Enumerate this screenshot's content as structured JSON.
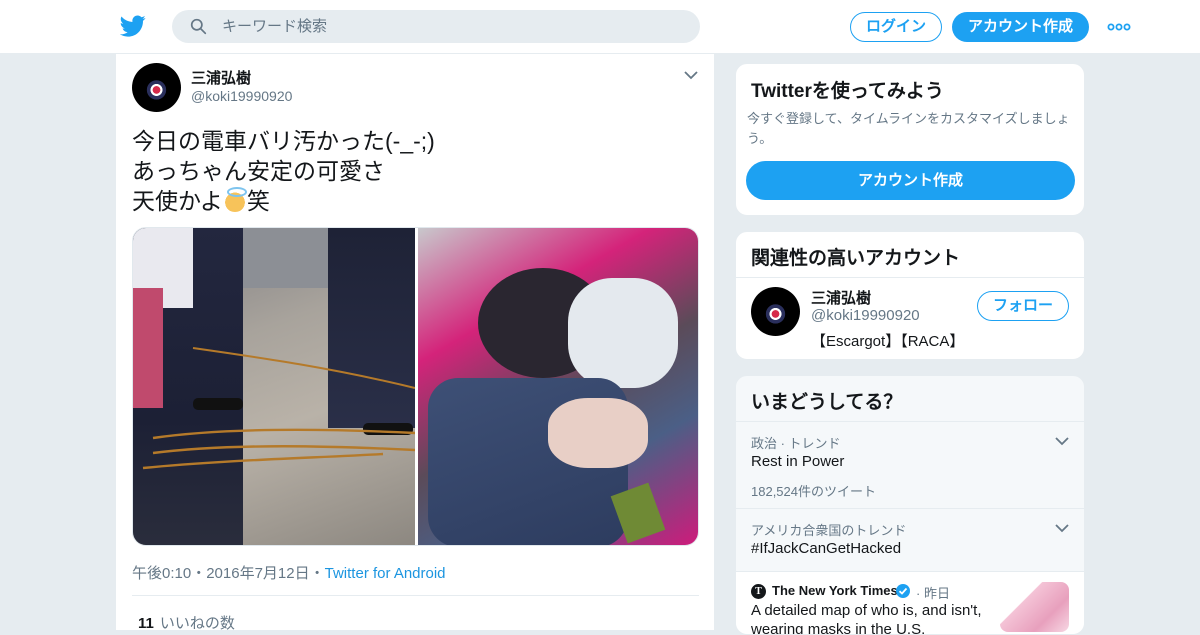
{
  "search": {
    "placeholder": "キーワード検索"
  },
  "nav": {
    "login_label": "ログイン",
    "signup_label": "アカウント作成"
  },
  "tweet": {
    "author_name": "三浦弘樹",
    "author_handle": "@koki19990920",
    "text_line1": "今日の電車バリ汚かった(-_-;)",
    "text_line2": "あっちゃん安定の可愛さ",
    "text_line3_before": "天使かよ",
    "text_line3_after": "笑",
    "time": "午後0:10",
    "date": "2016年7月12日",
    "sep": "・",
    "source": "Twitter for Android",
    "likes_count": "11",
    "likes_label": "いいねの数"
  },
  "signup_card": {
    "title": "Twitterを使ってみよう",
    "description": "今すぐ登録して、タイムラインをカスタマイズしましょう。",
    "button_label": "アカウント作成"
  },
  "related_card": {
    "title": "関連性の高いアカウント",
    "account_name": "三浦弘樹",
    "account_handle": "@koki19990920",
    "account_bio": "【Escargot】【RACA】",
    "follow_label": "フォロー"
  },
  "trends_card": {
    "title": "いまどうしてる？",
    "trends": [
      {
        "category": "政治 · トレンド",
        "title": "Rest in Power",
        "count": "182,524件のツイート"
      },
      {
        "category": "アメリカ合衆国のトレンド",
        "title": "#IfJackCanGetHacked"
      }
    ],
    "news": {
      "publisher": "The New York Times",
      "when": "· 昨日",
      "headline": "A detailed map of who is, and isn't, wearing masks in the U.S."
    }
  },
  "colors": {
    "accent": "#1da1f2",
    "link": "#1b95e0",
    "muted": "#657786",
    "background": "#e6ecf0"
  }
}
